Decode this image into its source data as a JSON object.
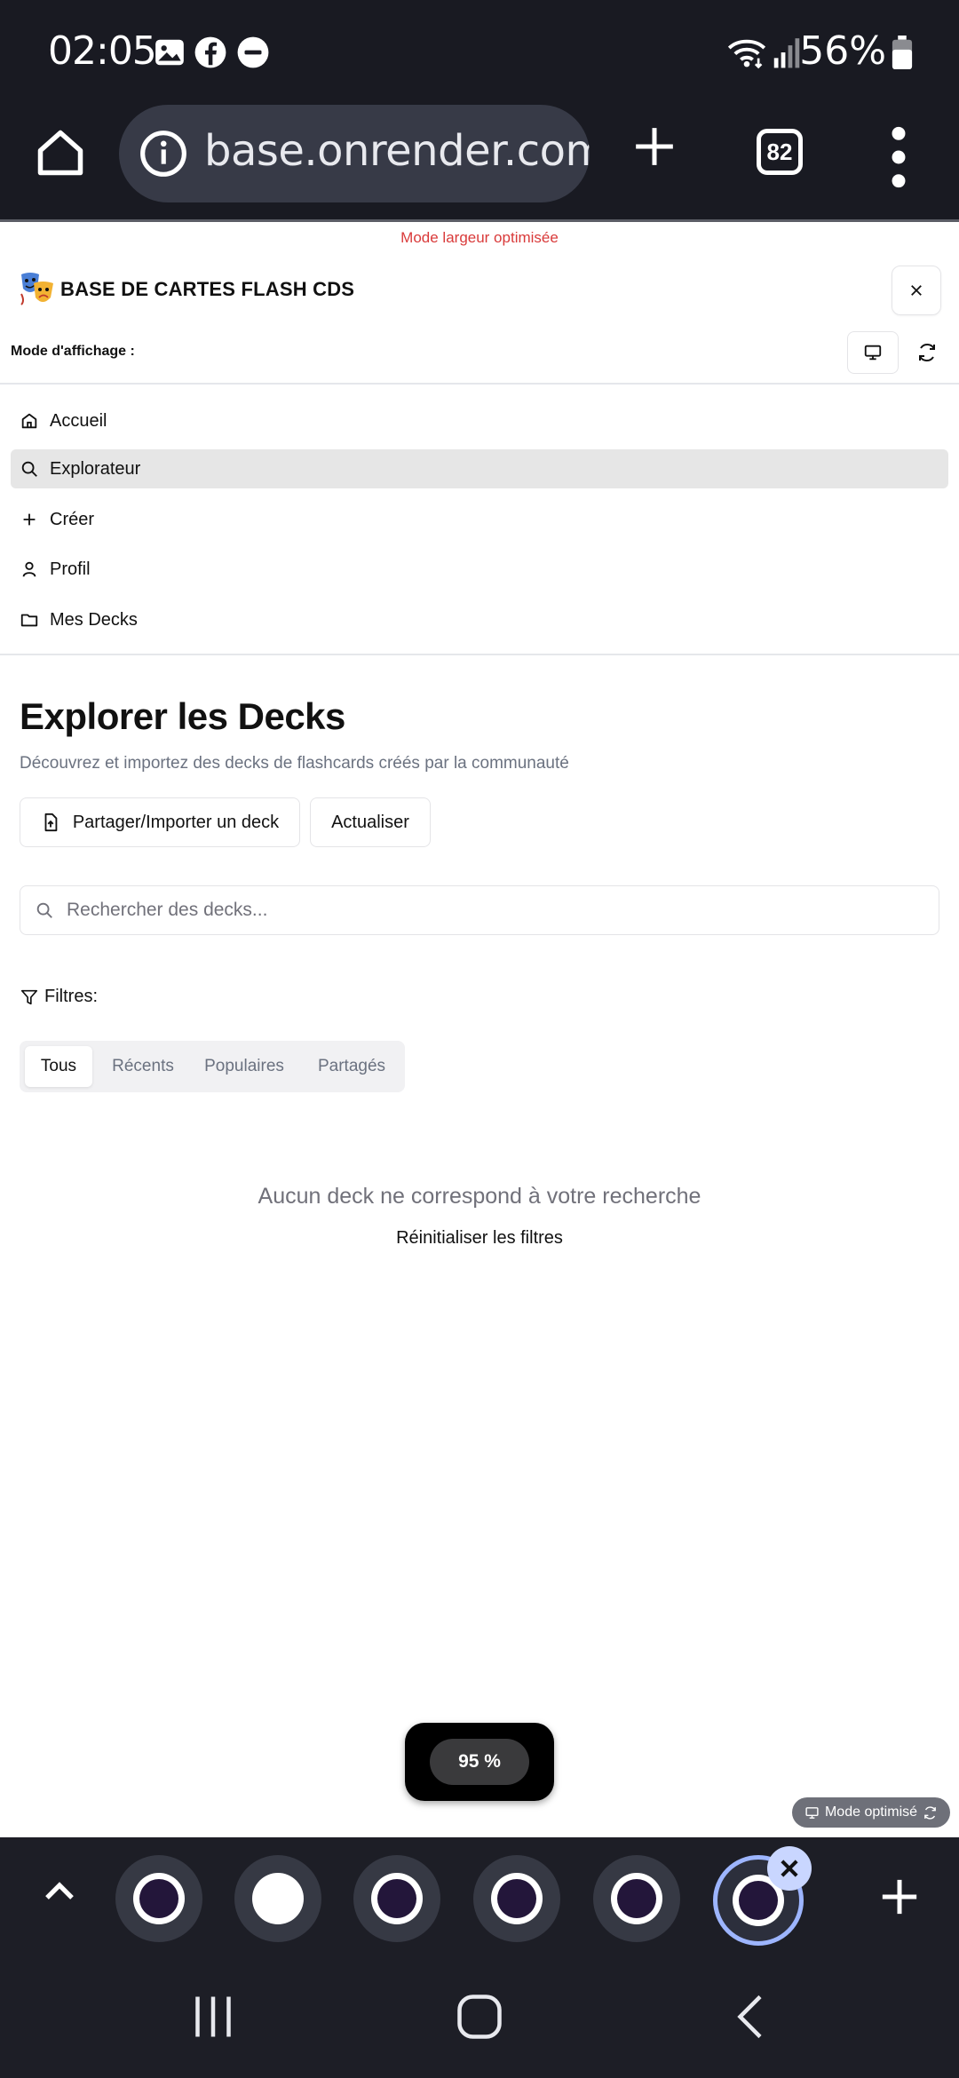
{
  "status_bar": {
    "time": "02:05",
    "battery": "56%",
    "icons": [
      "gallery-icon",
      "facebook-icon",
      "do-not-disturb-icon",
      "wifi-icon",
      "signal-icon",
      "battery-icon"
    ]
  },
  "browser": {
    "url": "base.onrender.com",
    "tab_count": "82",
    "icons": [
      "home-icon",
      "info-icon",
      "plus-icon",
      "tabs-icon",
      "more-vertical-icon"
    ]
  },
  "page": {
    "mode_banner": "Mode largeur optimisée",
    "app_title": "BASE DE CARTES FLASH CDS",
    "display_mode_label": "Mode d'affichage :",
    "nav": [
      {
        "label": "Accueil",
        "icon": "home-icon"
      },
      {
        "label": "Explorateur",
        "icon": "search-icon",
        "active": true
      },
      {
        "label": "Créer",
        "icon": "plus-icon"
      },
      {
        "label": "Profil",
        "icon": "user-icon"
      },
      {
        "label": "Mes Decks",
        "icon": "folder-icon"
      }
    ],
    "heading": "Explorer les Decks",
    "subtitle": "Découvrez et importez des decks de flashcards créés par la communauté",
    "share_button": "Partager/Importer un deck",
    "refresh_button": "Actualiser",
    "search_placeholder": "Rechercher des decks...",
    "filters_label": "Filtres:",
    "filter_tabs": [
      "Tous",
      "Récents",
      "Populaires",
      "Partagés"
    ],
    "active_filter": "Tous",
    "empty_message": "Aucun deck ne correspond à votre recherche",
    "reset_filters": "Réinitialiser les filtres",
    "zoom_level": "95 %",
    "optimized_badge": "Mode optimisé"
  },
  "colors": {
    "chrome_bg": "#191a22",
    "banner_red": "#d93a3a",
    "active_nav_bg": "#e6e6e6",
    "active_tab_ring": "#9db5ff"
  }
}
